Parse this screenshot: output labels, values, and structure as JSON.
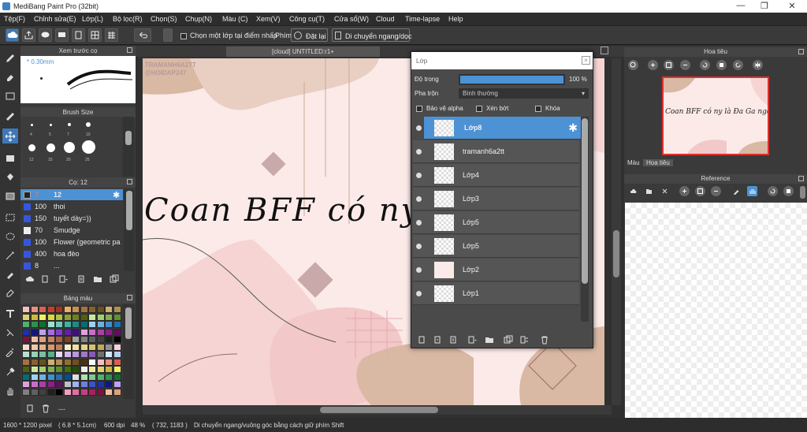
{
  "window": {
    "title": "MediBang Paint Pro (32bit)",
    "minimize": "—",
    "maximize": "❐",
    "close": "✕"
  },
  "menu": [
    "Tệp(F)",
    "Chỉnh sửa(E)",
    "Lớp(L)",
    "Bộ lọc(R)",
    "Chọn(S)",
    "Chụp(N)",
    "Màu (C)",
    "Xem(V)",
    "Công cụ(T)",
    "Cửa sổ(W)",
    "Cloud",
    "Time-lapse",
    "Help"
  ],
  "toolbar": {
    "pick_layer_label": "Chọn một lớp tại điểm nhấp",
    "shortcut_label": "Phím",
    "reset_label": "Đặt lại",
    "move_label": "Di chuyển ngang/dọc"
  },
  "panels": {
    "brush_preview": {
      "title": "Xem trước cọ",
      "size": "0.30mm"
    },
    "brush_size": {
      "title": "Brush Size",
      "labels": [
        "4",
        "5",
        "7",
        "10",
        "12",
        "15",
        "20",
        "25"
      ]
    },
    "brush": {
      "title": "Cọ: 12",
      "items": [
        {
          "size": "7",
          "name": "",
          "selected_size": "12",
          "selected": true
        },
        {
          "size": "100",
          "name": "thoi",
          "selected": false
        },
        {
          "size": "150",
          "name": "tuyết dày=))",
          "selected": false
        },
        {
          "size": "70",
          "name": "Smudge",
          "selected": false
        },
        {
          "size": "100",
          "name": "Flower (geometric pa",
          "selected": false
        },
        {
          "size": "400",
          "name": "hoa đèo",
          "selected": false
        },
        {
          "size": "8",
          "name": "...",
          "selected": false
        }
      ]
    },
    "palette": {
      "title": "Bảng màu",
      "footer": "---"
    },
    "navigator": {
      "title": "Hoa tiêu",
      "tabs": [
        "Màu",
        "Hoa tiêu"
      ],
      "preview_text": "Coan BFF có ny là Đa Ga ngốn..."
    },
    "reference": {
      "title": "Reference"
    }
  },
  "document": {
    "tab": "[cloud] UNTITLED:r1+",
    "watermark1": "TRAMANH6A2TT",
    "watermark2": "@HOIDAP247",
    "script": "Coan BFF có ny là Đ"
  },
  "layers": {
    "title": "Lớp",
    "opacity_label": "Độ trong",
    "opacity_value": "100 %",
    "opacity": 1.0,
    "blend_label": "Pha trộn",
    "blend_value": "Bình thường",
    "alpha_protect": "Bảo vệ alpha",
    "clipping": "Xén bớt",
    "lock": "Khóa",
    "items": [
      {
        "name": "Lớp8",
        "selected": true
      },
      {
        "name": "tramanh6a2tt",
        "selected": false
      },
      {
        "name": "Lớp4",
        "selected": false
      },
      {
        "name": "Lớp3",
        "selected": false
      },
      {
        "name": "Lớp5",
        "selected": false
      },
      {
        "name": "Lớp5",
        "selected": false
      },
      {
        "name": "Lớp2",
        "selected": false
      },
      {
        "name": "Lớp1",
        "selected": false
      }
    ]
  },
  "status": {
    "size_px": "1600 * 1200 pixel",
    "size_cm": "( 6.8 * 5.1cm)",
    "dpi": "600 dpi",
    "zoom": "48 %",
    "coords": "( 732, 1183 )",
    "hint": "Di chuyển ngang/vuông góc bằng cách giữ phím Shift"
  },
  "colors": {
    "accent": "#4c92d4",
    "brush_swatch": "#3556e0",
    "nav_frame": "#e03030"
  }
}
